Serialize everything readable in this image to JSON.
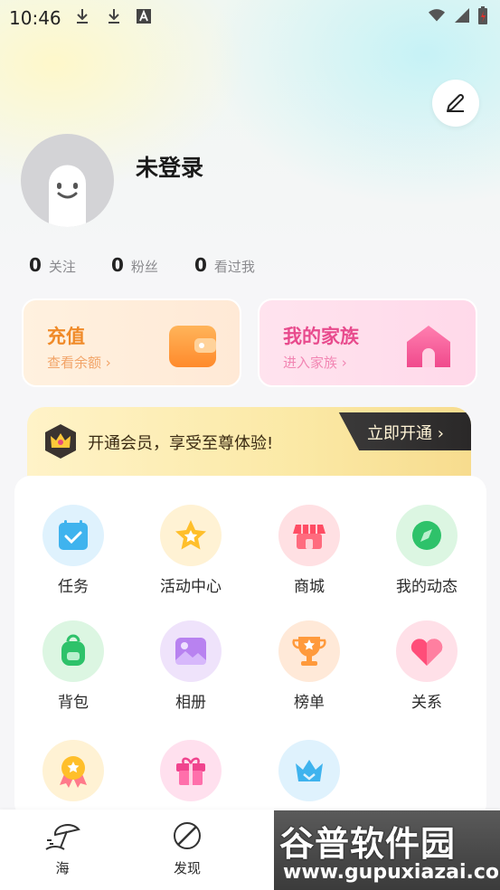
{
  "status_bar": {
    "time": "10:46"
  },
  "profile": {
    "name": "未登录"
  },
  "stats": [
    {
      "num": "0",
      "label": "关注"
    },
    {
      "num": "0",
      "label": "粉丝"
    },
    {
      "num": "0",
      "label": "看过我"
    }
  ],
  "cards": {
    "recharge": {
      "title": "充值",
      "sub": "查看余额 ›"
    },
    "family": {
      "title": "我的家族",
      "sub": "进入家族 ›"
    }
  },
  "vip": {
    "text": "开通会员，享受至尊体验!",
    "button": "立即开通 ›"
  },
  "menu": [
    {
      "label": "任务",
      "icon": "task-icon"
    },
    {
      "label": "活动中心",
      "icon": "star-icon"
    },
    {
      "label": "商城",
      "icon": "store-icon"
    },
    {
      "label": "我的动态",
      "icon": "compass-icon"
    },
    {
      "label": "背包",
      "icon": "backpack-icon"
    },
    {
      "label": "相册",
      "icon": "album-icon"
    },
    {
      "label": "榜单",
      "icon": "trophy-icon"
    },
    {
      "label": "关系",
      "icon": "heart-icon"
    },
    {
      "label": "",
      "icon": "medal-icon"
    },
    {
      "label": "",
      "icon": "gift-icon"
    },
    {
      "label": "",
      "icon": "crown-icon"
    }
  ],
  "tabs": [
    {
      "label": "海"
    },
    {
      "label": "发现"
    }
  ],
  "watermark": {
    "title": "谷普软件园",
    "url": "www.gupuxiazai.com"
  }
}
